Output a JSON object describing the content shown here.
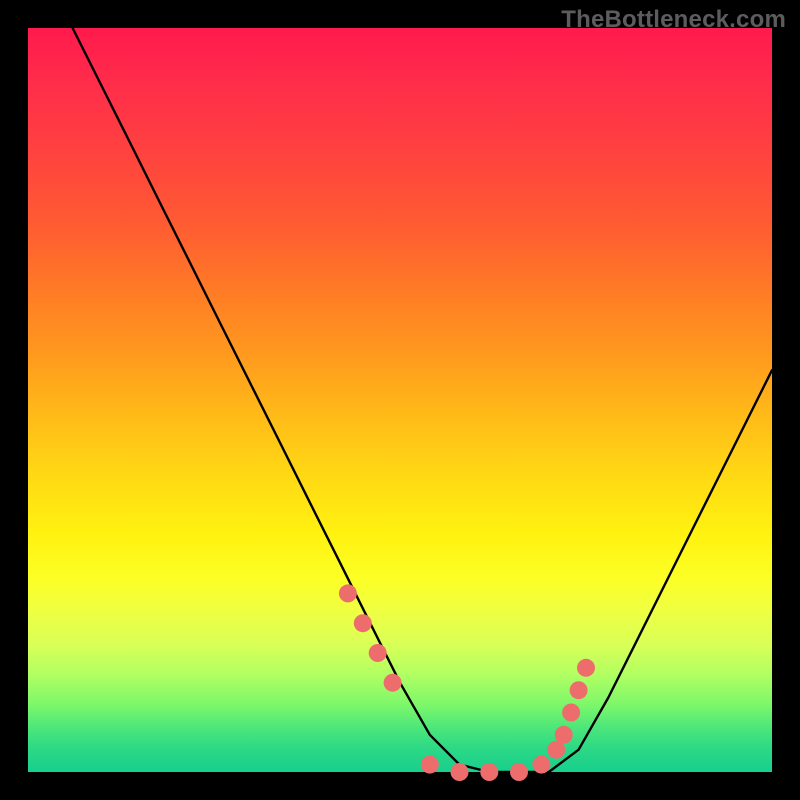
{
  "watermark": "TheBottleneck.com",
  "chart_data": {
    "type": "line",
    "title": "",
    "xlabel": "",
    "ylabel": "",
    "xlim": [
      0,
      100
    ],
    "ylim": [
      0,
      100
    ],
    "grid": false,
    "legend": false,
    "x": [
      6,
      10,
      14,
      18,
      22,
      26,
      30,
      34,
      38,
      42,
      46,
      50,
      54,
      58,
      62,
      66,
      70,
      74,
      78,
      82,
      86,
      90,
      94,
      98,
      100
    ],
    "y": [
      100,
      92,
      84,
      76,
      68,
      60,
      52,
      44,
      36,
      28,
      20,
      12,
      5,
      1,
      0,
      0,
      0,
      3,
      10,
      18,
      26,
      34,
      42,
      50,
      54
    ],
    "optimum_markers_x": [
      43,
      45,
      47,
      49,
      54,
      58,
      62,
      66,
      69,
      71,
      72,
      73,
      74,
      75
    ],
    "optimum_markers_y": [
      24,
      20,
      16,
      12,
      1,
      0,
      0,
      0,
      1,
      3,
      5,
      8,
      11,
      14
    ],
    "marker_color": "#ed6d6d",
    "curve_color": "#000000"
  }
}
